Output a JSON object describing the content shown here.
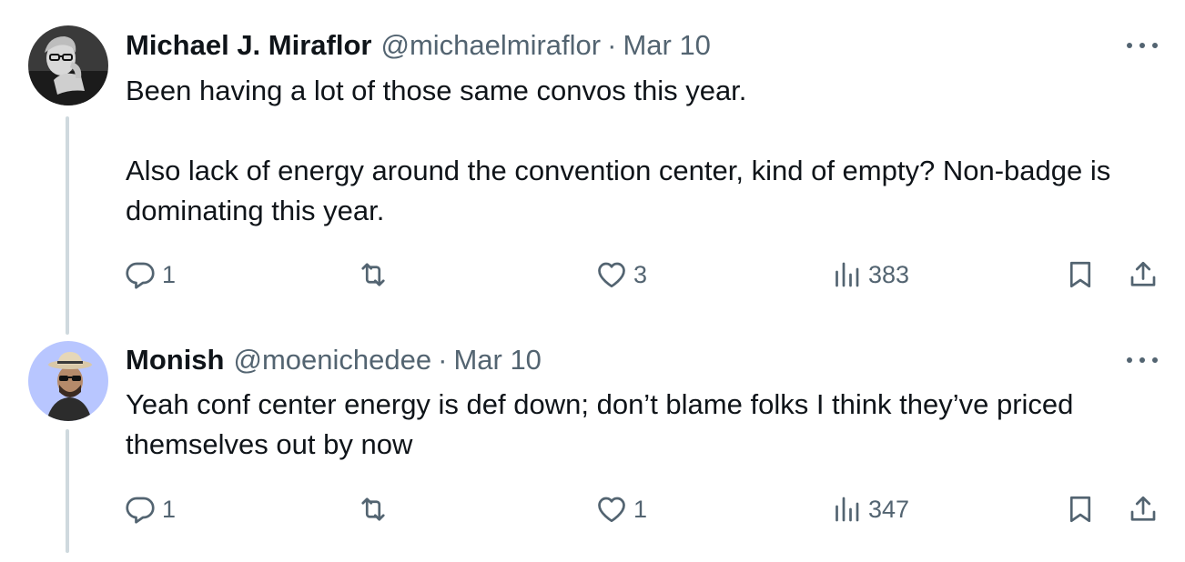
{
  "colors": {
    "text_primary": "#0f1419",
    "text_secondary": "#536471",
    "thread_line": "#cfd9de",
    "avatar2_bg": "#b8c6ff"
  },
  "tweets": [
    {
      "name": "Michael J. Miraflor",
      "handle": "@michaelmiraflor",
      "separator": "·",
      "date": "Mar 10",
      "avatar": "person-photo-avatar",
      "paragraphs": [
        "Been having a lot of those same convos this year.",
        "Also lack of energy around the convention center, kind of empty? Non-badge is dominating this year."
      ],
      "actions": {
        "replies": "1",
        "reposts": "",
        "likes": "3",
        "views": "383"
      }
    },
    {
      "name": "Monish",
      "handle": "@moenichedee",
      "separator": "·",
      "date": "Mar 10",
      "avatar": "person-hat-avatar",
      "paragraphs": [
        "Yeah conf center energy is def down; don’t blame folks I think they’ve priced themselves out by now"
      ],
      "actions": {
        "replies": "1",
        "reposts": "",
        "likes": "1",
        "views": "347"
      }
    }
  ],
  "icons": {
    "reply": "reply-icon",
    "repost": "repost-icon",
    "like": "heart-icon",
    "views": "views-chart-icon",
    "bookmark": "bookmark-icon",
    "share": "share-icon",
    "more": "more-dots-icon"
  }
}
